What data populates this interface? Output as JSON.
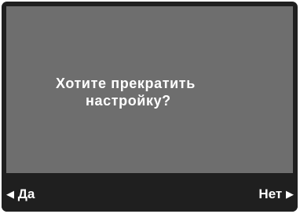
{
  "dialog": {
    "message_line1": "Хотите прекратить",
    "message_line2": "настройку?"
  },
  "softkeys": {
    "left_label": "Да",
    "right_label": "Нет",
    "left_arrow": "◀",
    "right_arrow": "▶"
  },
  "colors": {
    "screen_background": "#6e6e6e",
    "bezel": "#1f1f1f",
    "text": "#ffffff"
  }
}
